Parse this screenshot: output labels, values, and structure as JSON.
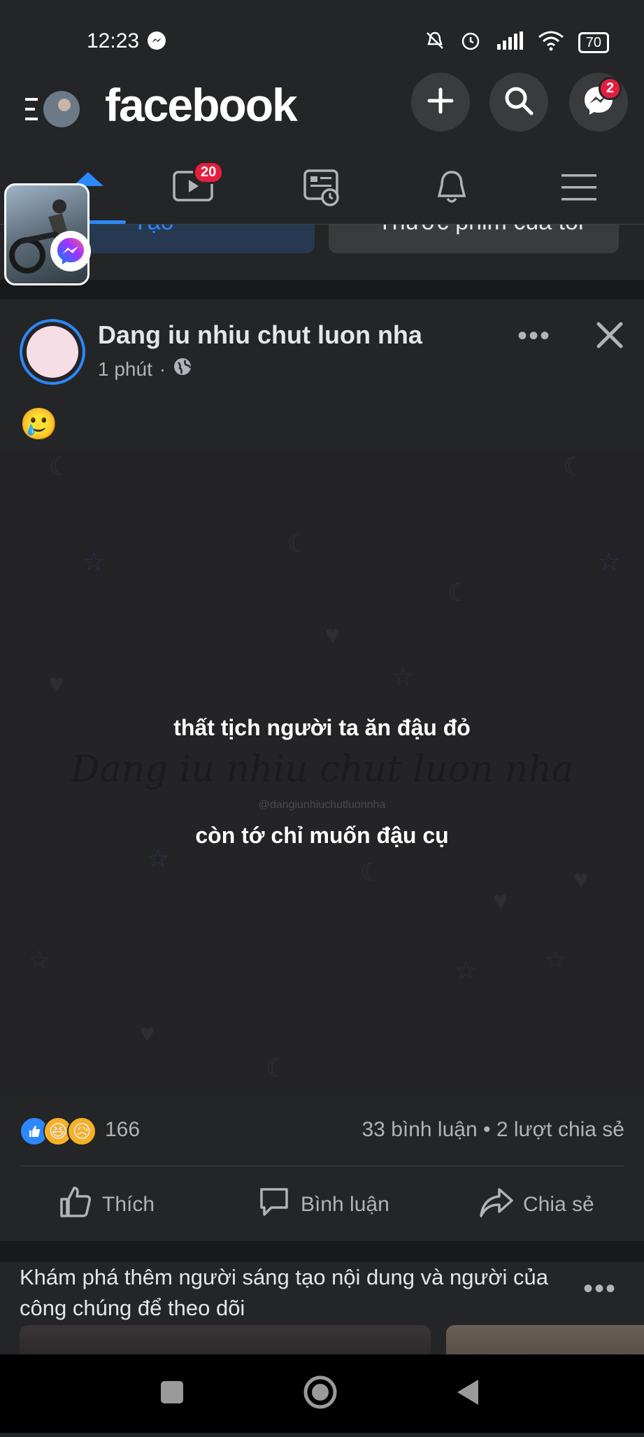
{
  "status_bar": {
    "time": "12:23",
    "battery": "70"
  },
  "header": {
    "logo": "facebook",
    "messenger_badge": "2"
  },
  "tabs": {
    "watch_badge": "20"
  },
  "stories": {
    "create_label": "Tạo",
    "reel_label": "Thước phim của tôi"
  },
  "post": {
    "author": "Dang iu nhiu chut luon nha",
    "time": "1 phút",
    "dot": "·",
    "body_emoji": "🥲",
    "image": {
      "line1": "thất tịch người ta ăn đậu đỏ",
      "line2": "còn tớ chỉ muốn đậu cụ",
      "watermark": "Dang iu nhiu chut luon nha",
      "handle": "@dangiunhiuchutluonnha"
    },
    "reaction_count": "166",
    "comments": "33 bình luận",
    "shares": "2 lượt chia sẻ",
    "stats_sep": " • ",
    "actions": {
      "like": "Thích",
      "comment": "Bình luận",
      "share": "Chia sẻ"
    }
  },
  "suggest": {
    "text": "Khám phá thêm người sáng tạo nội dung và người của công chúng để theo dõi"
  },
  "colors": {
    "accent": "#2d88ff",
    "badge": "#e41e3f",
    "background": "#18191a",
    "surface": "#242526"
  }
}
